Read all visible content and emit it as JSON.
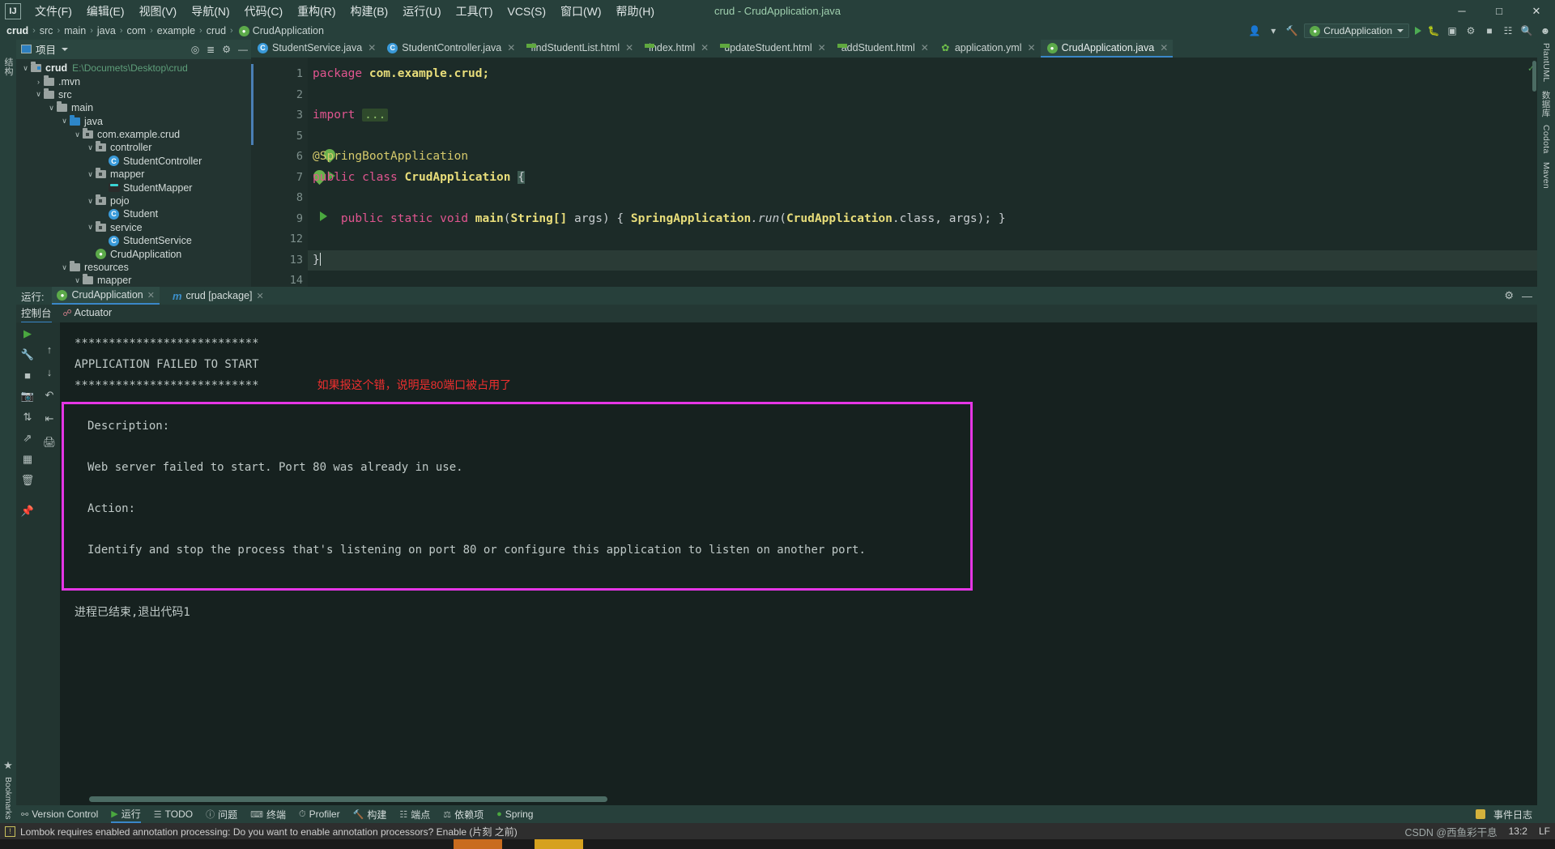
{
  "window": {
    "title": "crud - CrudApplication.java",
    "logo": "IJ",
    "minimize": "─",
    "maximize": "□",
    "close": "✕"
  },
  "menu": [
    {
      "label": "文件(F)"
    },
    {
      "label": "编辑(E)"
    },
    {
      "label": "视图(V)"
    },
    {
      "label": "导航(N)"
    },
    {
      "label": "代码(C)"
    },
    {
      "label": "重构(R)"
    },
    {
      "label": "构建(B)"
    },
    {
      "label": "运行(U)"
    },
    {
      "label": "工具(T)"
    },
    {
      "label": "VCS(S)"
    },
    {
      "label": "窗口(W)"
    },
    {
      "label": "帮助(H)"
    }
  ],
  "breadcrumb": {
    "items": [
      "crud",
      "src",
      "main",
      "java",
      "com",
      "example",
      "crud",
      "CrudApplication"
    ],
    "separator": "›"
  },
  "nav_right": {
    "run_config": "CrudApplication",
    "profile_icon": "person-icon",
    "hammer_icon": "build-icon",
    "run_icon": "run-icon",
    "debug_icon": "debug-icon",
    "coverage_icon": "coverage-icon",
    "profiler_icon": "profiler-icon",
    "stop_icon": "stop-icon",
    "search_icon": "search-icon",
    "settings_icon": "settings-icon",
    "account_icon": "account-icon"
  },
  "project": {
    "header_title": "项目",
    "icons": [
      "locate-icon",
      "collapse-icon",
      "settings-icon",
      "hide-icon"
    ],
    "tree": [
      {
        "depth": 0,
        "arrow": "∨",
        "icon": "module-folder",
        "label": "crud",
        "bold": true,
        "path": "E:\\Documets\\Desktop\\crud"
      },
      {
        "depth": 1,
        "arrow": "›",
        "icon": "folder",
        "label": ".mvn",
        "bold": false,
        "path": ""
      },
      {
        "depth": 1,
        "arrow": "∨",
        "icon": "folder",
        "label": "src",
        "bold": false,
        "path": ""
      },
      {
        "depth": 2,
        "arrow": "∨",
        "icon": "folder",
        "label": "main",
        "bold": false,
        "path": ""
      },
      {
        "depth": 3,
        "arrow": "∨",
        "icon": "folder-blue",
        "label": "java",
        "bold": false,
        "path": ""
      },
      {
        "depth": 4,
        "arrow": "∨",
        "icon": "package",
        "label": "com.example.crud",
        "bold": false,
        "path": ""
      },
      {
        "depth": 5,
        "arrow": "∨",
        "icon": "package",
        "label": "controller",
        "bold": false,
        "path": ""
      },
      {
        "depth": 6,
        "arrow": "",
        "icon": "class",
        "label": "StudentController",
        "bold": false,
        "path": ""
      },
      {
        "depth": 5,
        "arrow": "∨",
        "icon": "package",
        "label": "mapper",
        "bold": false,
        "path": ""
      },
      {
        "depth": 6,
        "arrow": "",
        "icon": "mapper",
        "label": "StudentMapper",
        "bold": false,
        "path": ""
      },
      {
        "depth": 5,
        "arrow": "∨",
        "icon": "package",
        "label": "pojo",
        "bold": false,
        "path": ""
      },
      {
        "depth": 6,
        "arrow": "",
        "icon": "class",
        "label": "Student",
        "bold": false,
        "path": ""
      },
      {
        "depth": 5,
        "arrow": "∨",
        "icon": "package",
        "label": "service",
        "bold": false,
        "path": ""
      },
      {
        "depth": 6,
        "arrow": "",
        "icon": "class",
        "label": "StudentService",
        "bold": false,
        "path": ""
      },
      {
        "depth": 5,
        "arrow": "",
        "icon": "spring",
        "label": "CrudApplication",
        "bold": false,
        "path": ""
      },
      {
        "depth": 3,
        "arrow": "∨",
        "icon": "folder",
        "label": "resources",
        "bold": false,
        "path": ""
      },
      {
        "depth": 4,
        "arrow": "∨",
        "icon": "folder",
        "label": "mapper",
        "bold": false,
        "path": ""
      }
    ]
  },
  "editor": {
    "tabs": [
      {
        "label": "StudentService.java",
        "icon": "class-icon",
        "active": false
      },
      {
        "label": "StudentController.java",
        "icon": "class-icon",
        "active": false
      },
      {
        "label": "findStudentList.html",
        "icon": "html-icon",
        "active": false
      },
      {
        "label": "index.html",
        "icon": "html-icon",
        "active": false
      },
      {
        "label": "updateStudent.html",
        "icon": "html-icon",
        "active": false
      },
      {
        "label": "addStudent.html",
        "icon": "html-icon",
        "active": false
      },
      {
        "label": "application.yml",
        "icon": "yml-icon",
        "active": false
      },
      {
        "label": "CrudApplication.java",
        "icon": "spring-icon",
        "active": true
      }
    ],
    "close_glyph": "✕",
    "lines": [
      {
        "num": "1",
        "marker": "",
        "fold": false
      },
      {
        "num": "2",
        "marker": "",
        "fold": false
      },
      {
        "num": "3",
        "marker": "",
        "fold": true
      },
      {
        "num": "5",
        "marker": "",
        "fold": false
      },
      {
        "num": "6",
        "marker": "bean",
        "fold": false
      },
      {
        "num": "7",
        "marker": "spring-run",
        "fold": false
      },
      {
        "num": "8",
        "marker": "",
        "fold": false
      },
      {
        "num": "9",
        "marker": "run",
        "fold": true
      },
      {
        "num": "12",
        "marker": "",
        "fold": false
      },
      {
        "num": "13",
        "marker": "",
        "fold": false
      },
      {
        "num": "14",
        "marker": "",
        "fold": false
      }
    ],
    "code": {
      "l1_kw": "package",
      "l1_rest": " com.example.crud;",
      "l3_kw": "import",
      "l3_dots": "...",
      "l6_anno": "@SpringBootApplication",
      "l7_a": "public class ",
      "l7_name": "CrudApplication",
      "l7_brace": "{",
      "l9_a": "public static void ",
      "l9_main": "main",
      "l9_b": "(",
      "l9_str": "String[]",
      "l9_args": " args",
      "l9_c": ") { ",
      "l9_spring": "SpringApplication",
      "l9_run": ".run",
      "l9_d": "(",
      "l9_cls": "CrudApplication",
      "l9_class": ".class",
      "l9_e": ", args); }",
      "l13": "}"
    }
  },
  "run_panel": {
    "label": "运行:",
    "tabs": [
      {
        "label": "CrudApplication",
        "icon": "spring-icon",
        "active": true
      },
      {
        "label": "crud [package]",
        "icon": "maven-icon",
        "active": false
      }
    ],
    "close_glyph": "✕",
    "sub_tabs": [
      {
        "label": "控制台",
        "active": true
      },
      {
        "label": "Actuator",
        "active": false
      }
    ],
    "toolbar_right": [
      "settings-icon",
      "hide-icon"
    ],
    "rail_icons": [
      "rerun-icon",
      "up-icon",
      "down-icon",
      "wrap-icon",
      "soft-wrap-icon",
      "camera-icon",
      "scroll-end-icon",
      "export-icon",
      "print-icon",
      "grid-icon",
      "trash-icon",
      "pin-icon"
    ],
    "console": {
      "stars_top": "***************************",
      "failed_line": "APPLICATION FAILED TO START",
      "stars_bottom": "***************************",
      "annotation": "如果报这个错，说明是80端口被占用了",
      "desc_label": "Description:",
      "desc_text": "Web server failed to start. Port 80 was already in use.",
      "action_label": "Action:",
      "action_text": "Identify and stop the process that's listening on port 80 or configure this application to listen on another port.",
      "exit_line": "进程已结束,退出代码1"
    },
    "highlight_color": "#e536e5"
  },
  "bottom_bar": {
    "items": [
      {
        "label": "Version Control",
        "icon": "branch-icon",
        "active": false
      },
      {
        "label": "运行",
        "icon": "run-icon",
        "active": true
      },
      {
        "label": "TODO",
        "icon": "todo-icon",
        "active": false
      },
      {
        "label": "问题",
        "icon": "problems-icon",
        "active": false
      },
      {
        "label": "终端",
        "icon": "terminal-icon",
        "active": false
      },
      {
        "label": "Profiler",
        "icon": "profiler-icon",
        "active": false
      },
      {
        "label": "构建",
        "icon": "build-icon",
        "active": false
      },
      {
        "label": "端点",
        "icon": "endpoints-icon",
        "active": false
      },
      {
        "label": "依赖项",
        "icon": "dependencies-icon",
        "active": false
      },
      {
        "label": "Spring",
        "icon": "spring-icon",
        "active": false
      }
    ],
    "right": {
      "label": "事件日志",
      "icon": "event-log-icon"
    }
  },
  "left_rail": {
    "items": [
      "结构"
    ],
    "bookmarks": "Bookmarks"
  },
  "right_rail": {
    "items": [
      "PlantUML",
      "数据库",
      "Codota",
      "Maven"
    ]
  },
  "status_bar": {
    "warning_icon": "warning-icon",
    "message": "Lombok requires enabled annotation processing: Do you want to enable annotation processors? Enable (片刻 之前)",
    "position": "13:2",
    "encoding": "LF",
    "watermark": "CSDN @西鱼彩干息"
  }
}
